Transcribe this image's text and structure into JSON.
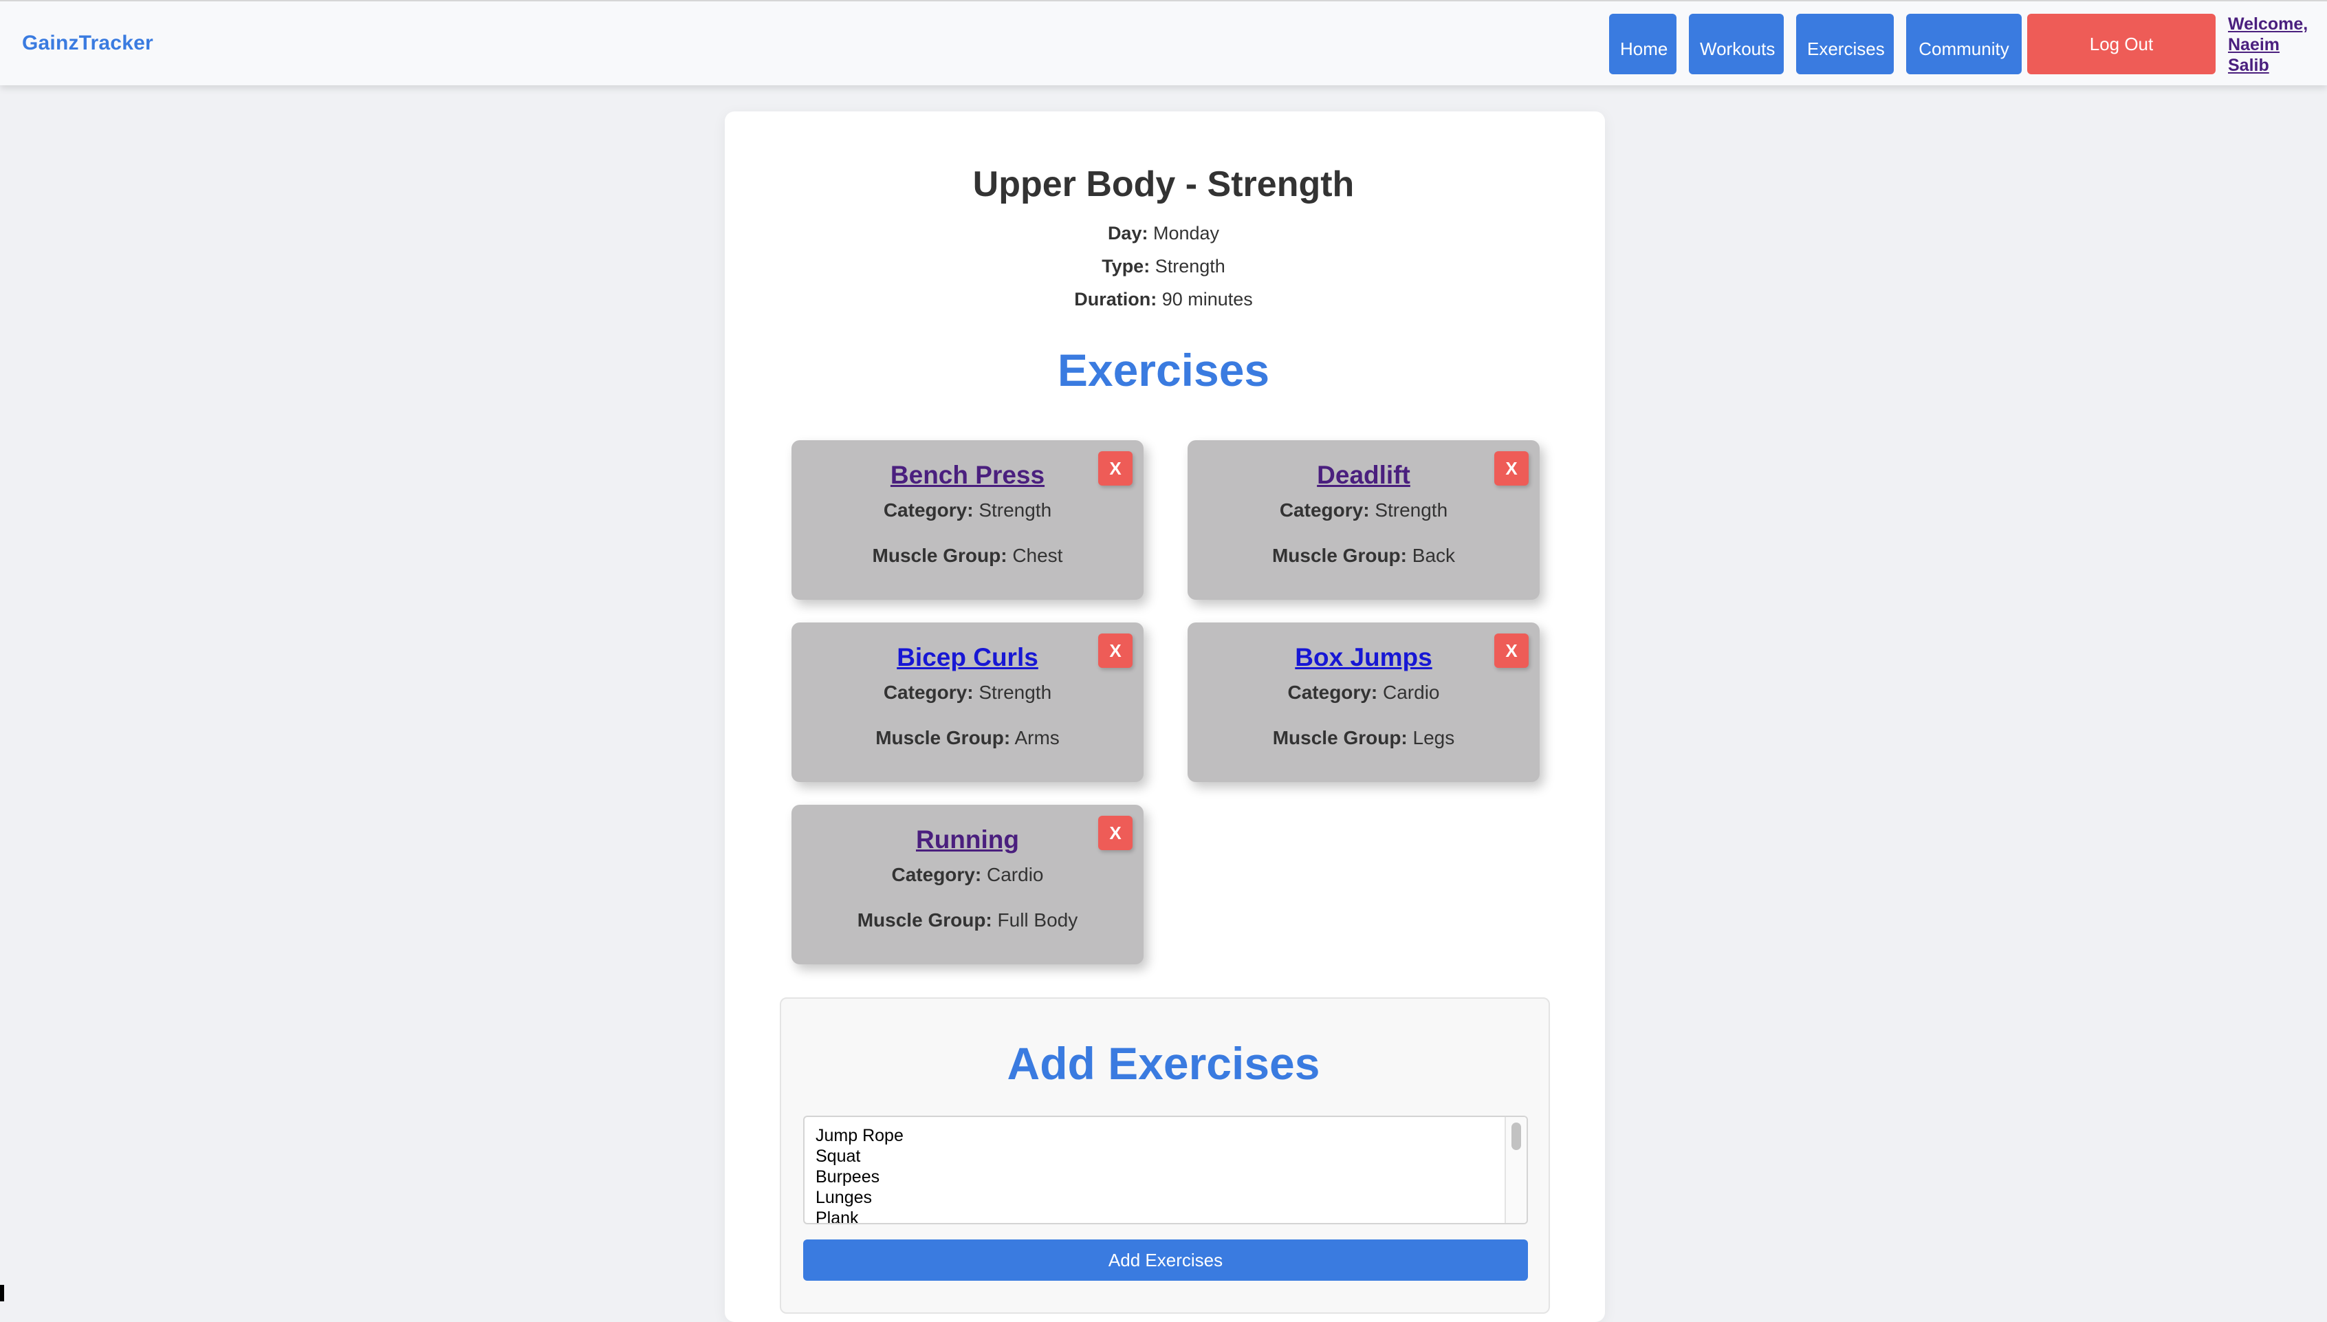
{
  "navbar": {
    "brand": "GainzTracker",
    "links": {
      "home": "Home",
      "workouts": "Workouts",
      "exercises": "Exercises",
      "community": "Community"
    },
    "logout_label": "Log Out",
    "welcome_text": "Welcome, Naeim Salib"
  },
  "workout": {
    "title": "Upper Body - Strength",
    "day_label": "Day:",
    "day": "Monday",
    "type_label": "Type:",
    "type": "Strength",
    "duration_label": "Duration:",
    "duration": "90 minutes"
  },
  "exercises_section": {
    "title": "Exercises",
    "category_label": "Category:",
    "muscle_group_label": "Muscle Group:",
    "remove_label": "X",
    "items": [
      {
        "name": "Bench Press",
        "category": "Strength",
        "muscle_group": "Chest"
      },
      {
        "name": "Deadlift",
        "category": "Strength",
        "muscle_group": "Back"
      },
      {
        "name": "Bicep Curls",
        "category": "Strength",
        "muscle_group": "Arms"
      },
      {
        "name": "Box Jumps",
        "category": "Cardio",
        "muscle_group": "Legs"
      },
      {
        "name": "Running",
        "category": "Cardio",
        "muscle_group": "Full Body"
      }
    ]
  },
  "add_exercises": {
    "title": "Add Exercises",
    "options": [
      "Jump Rope",
      "Squat",
      "Burpees",
      "Lunges",
      "Plank"
    ],
    "button_label": "Add Exercises"
  },
  "colors": {
    "accent": "#3a7be0",
    "danger": "#ee5c57",
    "card_bg": "#bfbebf",
    "visited_link": "#4a1f7e",
    "link": "#1717d4"
  }
}
